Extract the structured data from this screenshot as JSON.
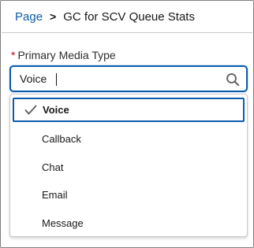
{
  "breadcrumb": {
    "parent": "Page",
    "separator": ">",
    "current": "GC for SCV Queue Stats"
  },
  "field": {
    "required_mark": "*",
    "label": "Primary Media Type",
    "value": "Voice"
  },
  "icons": {
    "search": "search-icon",
    "check": "check-icon"
  },
  "colors": {
    "accent": "#0b5cab",
    "required": "#ba0517"
  },
  "options": [
    {
      "label": "Voice",
      "selected": true
    },
    {
      "label": "Callback",
      "selected": false
    },
    {
      "label": "Chat",
      "selected": false
    },
    {
      "label": "Email",
      "selected": false
    },
    {
      "label": "Message",
      "selected": false
    }
  ]
}
